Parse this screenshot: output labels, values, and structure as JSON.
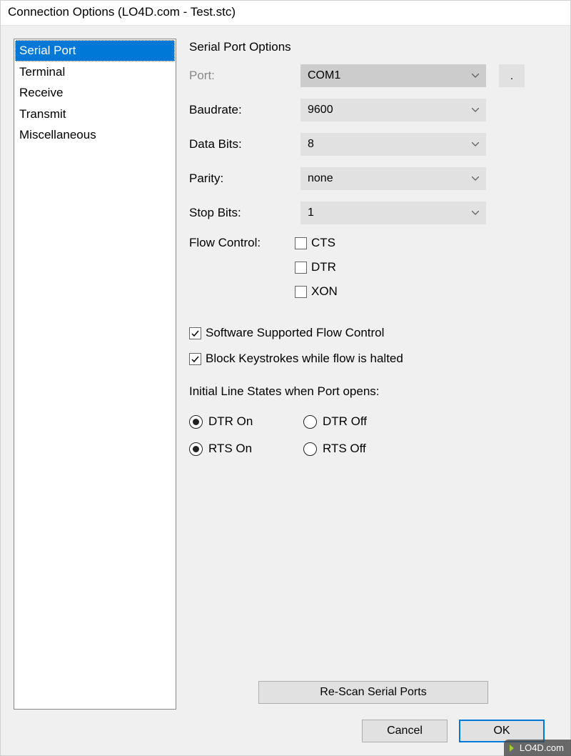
{
  "window": {
    "title": "Connection Options (LO4D.com - Test.stc)"
  },
  "sidebar": {
    "items": [
      {
        "label": "Serial Port",
        "selected": true
      },
      {
        "label": "Terminal",
        "selected": false
      },
      {
        "label": "Receive",
        "selected": false
      },
      {
        "label": "Transmit",
        "selected": false
      },
      {
        "label": "Miscellaneous",
        "selected": false
      }
    ]
  },
  "section": {
    "title": "Serial Port Options"
  },
  "fields": {
    "port_label": "Port:",
    "port_value": "COM1",
    "baudrate_label": "Baudrate:",
    "baudrate_value": "9600",
    "databits_label": "Data Bits:",
    "databits_value": "8",
    "parity_label": "Parity:",
    "parity_value": "none",
    "stopbits_label": "Stop Bits:",
    "stopbits_value": "1",
    "flowcontrol_label": "Flow Control:",
    "flow_cts": "CTS",
    "flow_dtr": "DTR",
    "flow_xon": "XON",
    "sw_flow": "Software Supported Flow Control",
    "block_keys": "Block Keystrokes while flow is halted"
  },
  "ils": {
    "label": "Initial Line States when Port opens:",
    "dtr_on": "DTR On",
    "dtr_off": "DTR Off",
    "rts_on": "RTS On",
    "rts_off": "RTS Off"
  },
  "buttons": {
    "rescan": "Re-Scan Serial Ports",
    "cancel": "Cancel",
    "ok": "OK",
    "browse": "."
  },
  "watermark": "LO4D.com"
}
